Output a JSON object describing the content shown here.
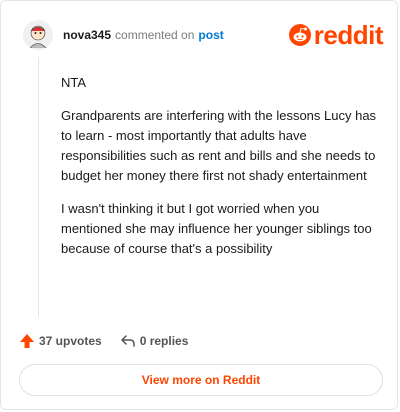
{
  "header": {
    "username": "nova345",
    "action_text": "commented on",
    "post_link": "post",
    "logo_text": "reddit"
  },
  "comment": {
    "paragraphs": [
      "NTA",
      "Grandparents are interfering with the lessons Lucy has to learn - most importantly that adults have responsibilities such as rent and bills and she needs to budget her money there first not shady entertainment",
      "I wasn't thinking it but I got worried when you mentioned she may influence her younger siblings too because of course that's a possibility"
    ]
  },
  "actions": {
    "upvotes": "37 upvotes",
    "replies": "0 replies"
  },
  "footer": {
    "view_more": "View more on Reddit"
  },
  "colors": {
    "brand": "#ff4500",
    "link": "#0079d3"
  },
  "icons": [
    "avatar",
    "reddit-snoo-icon",
    "upvote-arrow-icon",
    "reply-icon"
  ]
}
